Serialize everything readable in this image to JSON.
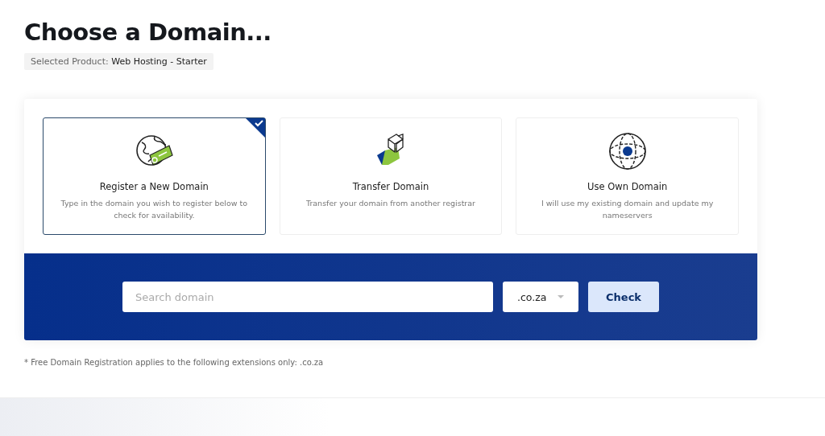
{
  "title": "Choose a Domain...",
  "selected_product": {
    "label": "Selected Product:",
    "value": "Web Hosting - Starter"
  },
  "options": [
    {
      "kind": "register",
      "title": "Register a New Domain",
      "description": "Type in the domain you wish to register below to check for availability.",
      "selected": true
    },
    {
      "kind": "transfer",
      "title": "Transfer Domain",
      "description": "Transfer your domain from another registrar",
      "selected": false
    },
    {
      "kind": "own",
      "title": "Use Own Domain",
      "description": "I will use my existing domain and update my nameservers",
      "selected": false
    }
  ],
  "search": {
    "placeholder": "Search domain",
    "extension": ".co.za",
    "button": "Check"
  },
  "footnote": "* Free Domain Registration applies to the following extensions only: .co.za"
}
